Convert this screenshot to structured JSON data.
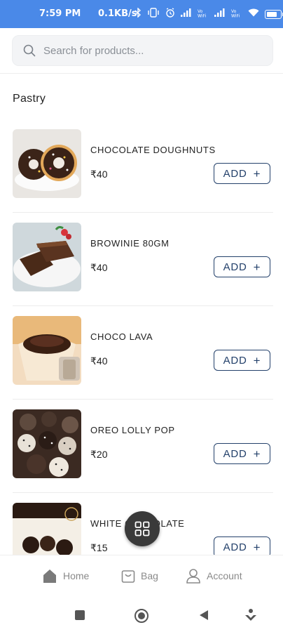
{
  "status_bar": {
    "time": "7:59 PM",
    "network_speed": "0.1KB/s",
    "icons": [
      "whatsapp-icon",
      "bluetooth-icon",
      "vibrate-icon",
      "alarm-icon",
      "signal-icon",
      "volte-icon",
      "signal-icon",
      "volte-icon",
      "wifi-icon",
      "battery-icon"
    ]
  },
  "search": {
    "placeholder": "Search for products..."
  },
  "section": {
    "title": "Pastry"
  },
  "products": [
    {
      "name": "CHOCOLATE DOUGHNUTS",
      "price": "₹40",
      "add_label": "ADD",
      "add_icon": "+"
    },
    {
      "name": "BROWINIE 80GM",
      "price": "₹40",
      "add_label": "ADD",
      "add_icon": "+"
    },
    {
      "name": "CHOCO LAVA",
      "price": "₹40",
      "add_label": "ADD",
      "add_icon": "+"
    },
    {
      "name": "OREO LOLLY POP",
      "price": "₹20",
      "add_label": "ADD",
      "add_icon": "+"
    },
    {
      "name": "WHITE CHOCOLATE",
      "price": "₹15",
      "add_label": "ADD",
      "add_icon": "+"
    }
  ],
  "bottom_nav": {
    "items": [
      {
        "label": "Home",
        "icon": "home-icon"
      },
      {
        "label": "Bag",
        "icon": "bag-icon"
      },
      {
        "label": "Account",
        "icon": "account-icon"
      }
    ]
  },
  "colors": {
    "status_bar": "#4a89e8",
    "accent": "#24416b",
    "fab": "#3a3a3a"
  }
}
